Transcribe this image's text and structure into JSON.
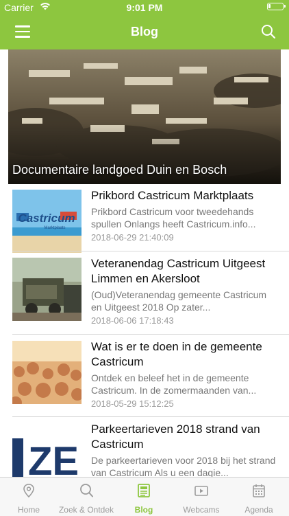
{
  "status": {
    "carrier": "Carrier",
    "time": "9:01 PM"
  },
  "header": {
    "title": "Blog"
  },
  "hero": {
    "caption": "Documentaire landgoed Duin en Bosch"
  },
  "posts": [
    {
      "title": "Prikbord Castricum Marktplaats",
      "excerpt": "Prikbord Castricum voor tweedehands spullen Onlangs heeft Castricum.info...",
      "date": "2018-06-29 21:40:09",
      "thumb_text": "Castricum",
      "thumb_sub": "Marktplaats"
    },
    {
      "title": "Veteranendag Castricum Uitgeest Limmen en Akersloot",
      "excerpt": "(Oud)Veteranendag gemeente Castricum en Uitgeest 2018 Op zater...",
      "date": "2018-06-06 17:18:43"
    },
    {
      "title": "Wat is er te doen in de gemeente Castricum",
      "excerpt": "Ontdek en beleef het in de gemeente Castricum. In de zomermaanden van...",
      "date": "2018-05-29 15:12:25"
    },
    {
      "title": "Parkeertarieven 2018 strand van Castricum",
      "excerpt": "De parkeertarieven voor 2018 bij het strand van Castricum Als u een dagie...",
      "date": "",
      "thumb_text": "ZE"
    }
  ],
  "tabs": [
    {
      "label": "Home",
      "icon": "location-pin-icon"
    },
    {
      "label": "Zoek & Ontdek",
      "icon": "search-icon"
    },
    {
      "label": "Blog",
      "icon": "blog-icon",
      "active": true
    },
    {
      "label": "Webcams",
      "icon": "webcam-icon"
    },
    {
      "label": "Agenda",
      "icon": "calendar-icon"
    }
  ],
  "colors": {
    "accent": "#8dc63f",
    "inactive": "#9b9b9b"
  }
}
